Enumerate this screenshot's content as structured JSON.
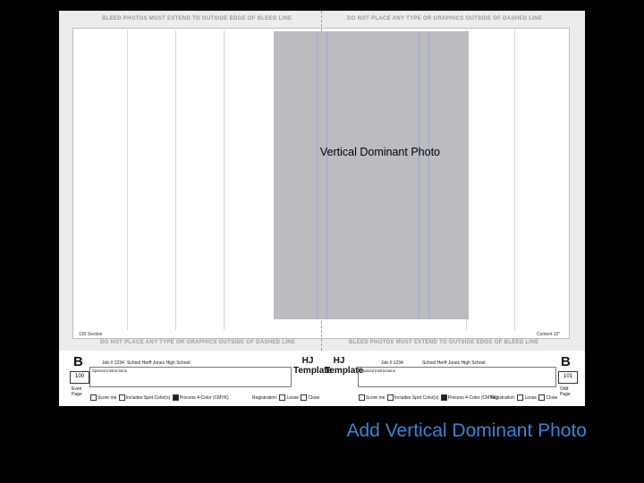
{
  "photo_label": "Vertical Dominant Photo",
  "top_bleed": {
    "left": "BLEED PHOTOS MUST EXTEND TO OUTSIDE EDGE OF BLEED LINE",
    "right": "DO NOT PLACE ANY TYPE OR GRAPHICS OUTSIDE OF DASHED LINE"
  },
  "bottom_bleed": {
    "left": "DO NOT PLACE ANY TYPE OR GRAPHICS OUTSIDE OF DASHED LINE",
    "right": "BLEED PHOTOS MUST EXTEND TO OUTSIDE EDGE OF BLEED LINE"
  },
  "section_left": "130 Section",
  "section_right": "Content 10\"",
  "footer": {
    "left": {
      "letter": "B",
      "job": "Job # 1234",
      "school": "School Herff Jones High School",
      "page": "100",
      "page_type": "Even Page",
      "instructions": "Special Instructions"
    },
    "right": {
      "letter": "B",
      "job": "Job # 1234",
      "school": "School Herff Jones High School",
      "page": "101",
      "page_type": "Odd Page",
      "instructions": "Special Instructions"
    },
    "template_a": "HJ Template",
    "template_b": "HJ Template",
    "options_left": [
      "Score me",
      "Includes Spot Color(s)",
      "Process 4-Color (CMYK)"
    ],
    "registration_left": "Registration:",
    "reg_opts_left": [
      "Loose",
      "Close"
    ],
    "options_right": [
      "Score me",
      "Includes Spot Color(s)",
      "Process 4-Color (CMYK)"
    ],
    "registration_right": "Registration:",
    "reg_opts_right": [
      "Loose",
      "Close"
    ]
  },
  "caption": "Add Vertical Dominant Photo"
}
